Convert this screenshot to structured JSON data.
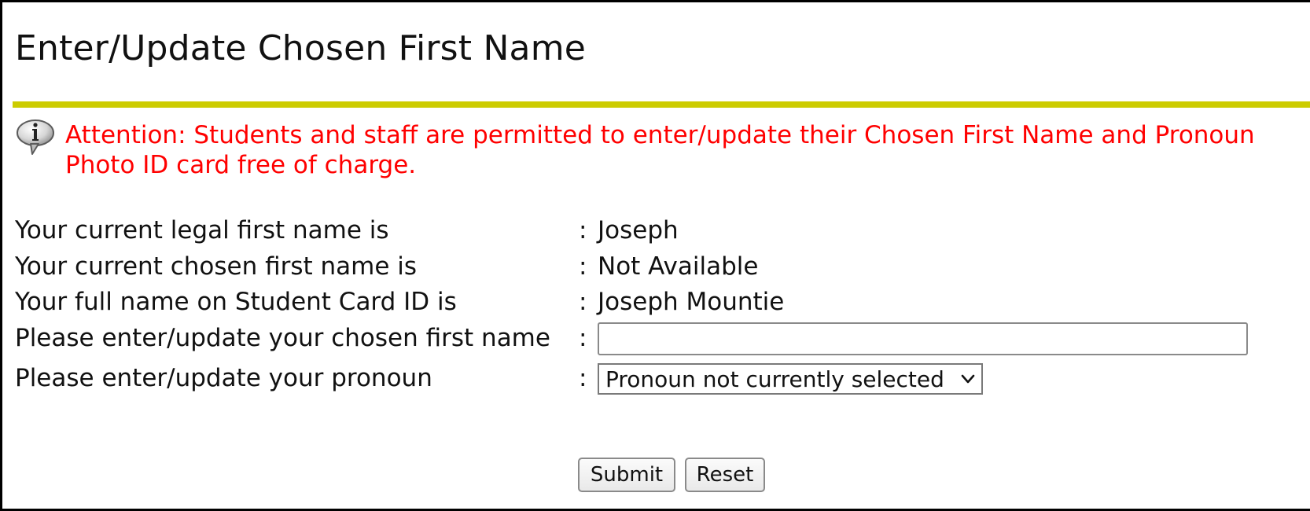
{
  "header": {
    "title": "Enter/Update Chosen First Name"
  },
  "attention": {
    "icon": "info-speech-bubble-icon",
    "line1": "Attention: Students and staff are permitted to enter/update their Chosen First Name and Pronoun",
    "line2": "Photo ID card free of charge."
  },
  "form": {
    "rows": [
      {
        "label": "Your current legal first name is",
        "colon": ":",
        "value": "Joseph"
      },
      {
        "label": "Your current chosen first name is",
        "colon": ":",
        "value": "Not Available"
      },
      {
        "label": "Your full name on Student Card ID is",
        "colon": ":",
        "value": "Joseph Mountie"
      },
      {
        "label": "Please enter/update your chosen first name",
        "colon": ":",
        "value": ""
      },
      {
        "label": "Please enter/update your pronoun",
        "colon": ":",
        "value": ""
      }
    ],
    "chosen_name_input": {
      "value": "",
      "placeholder": ""
    },
    "pronoun_select": {
      "selected": "Pronoun not currently selected"
    },
    "submit_label": "Submit",
    "reset_label": "Reset"
  },
  "colors": {
    "divider": "#cccc00",
    "attention_text": "#ff0000"
  }
}
